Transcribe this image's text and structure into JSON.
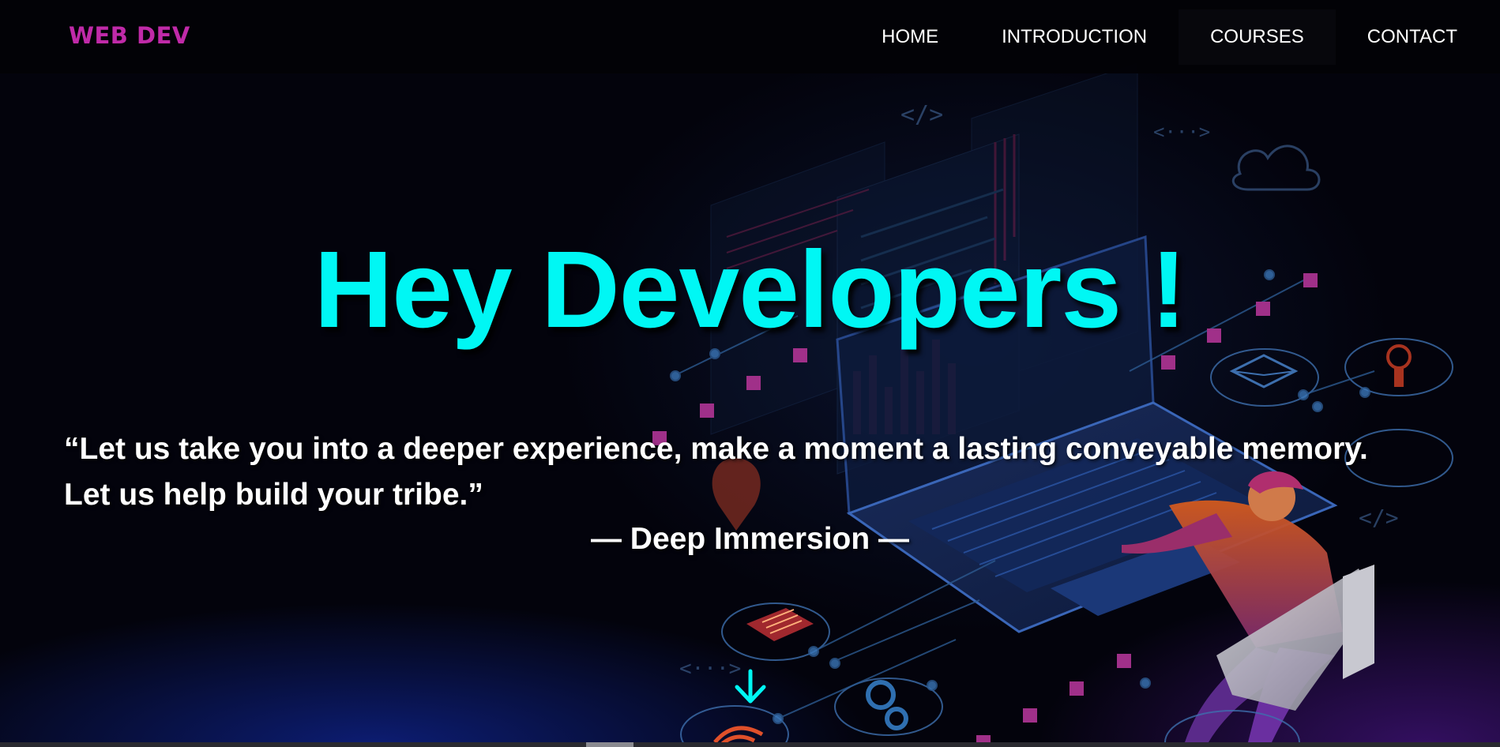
{
  "brand": {
    "logo_text": "WEB DEV",
    "logo_color": "#c02aa8"
  },
  "nav": {
    "items": [
      {
        "label": "HOME"
      },
      {
        "label": "INTRODUCTION"
      },
      {
        "label": "COURSES"
      },
      {
        "label": "CONTACT"
      }
    ]
  },
  "hero": {
    "title": "Hey Developers !",
    "title_color": "#00f7f4",
    "quote_line1": "“Let us take you into a deeper experience, make a moment a lasting conveyable memory.",
    "quote_line2": "Let us help build your tribe.”",
    "attribution": "— Deep Immersion —",
    "scroll_icon": "arrow-down-icon"
  },
  "colors": {
    "background": "#03030c",
    "accent": "#00f7f4",
    "brand": "#c02aa8"
  }
}
